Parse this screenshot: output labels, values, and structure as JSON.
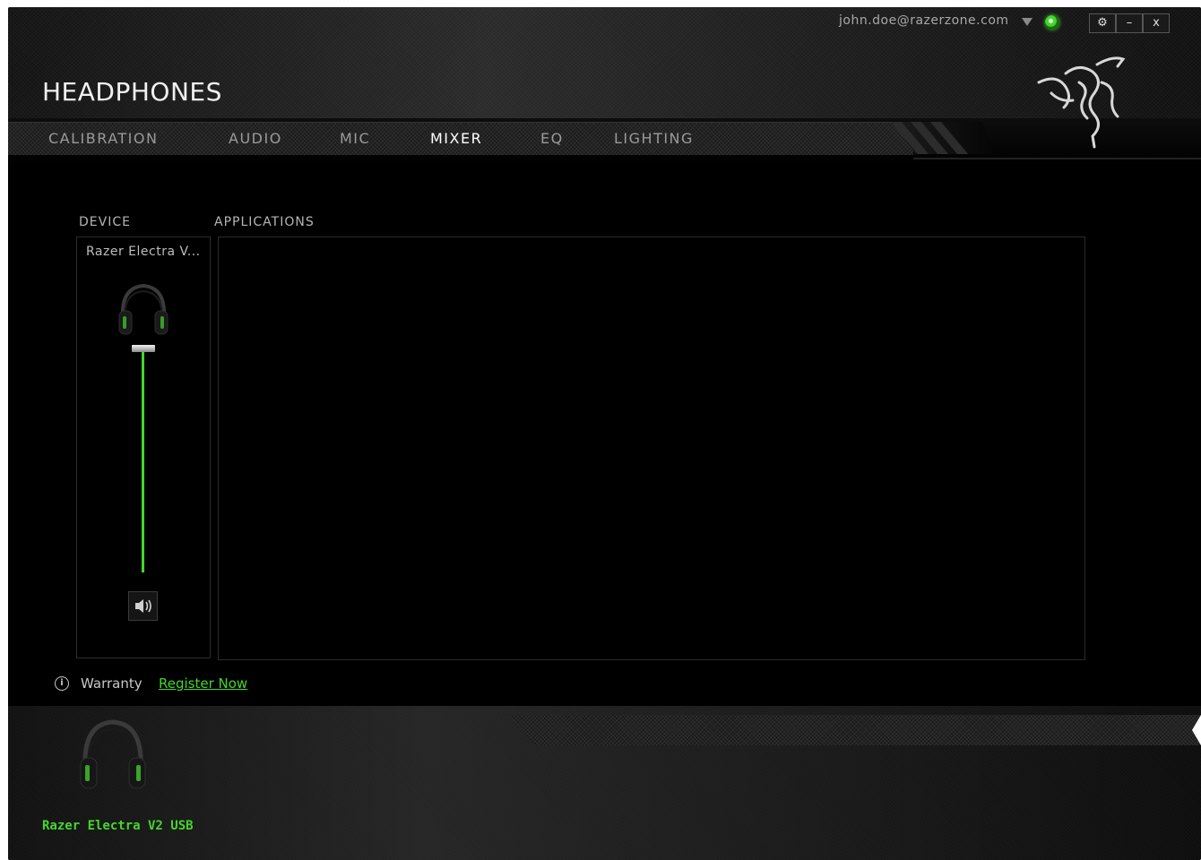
{
  "account": {
    "email": "john.doe@razerzone.com"
  },
  "window_controls": {
    "settings": "⚙",
    "minimize": "–",
    "close": "x"
  },
  "app": {
    "title": "HEADPHONES"
  },
  "tabs": [
    {
      "label": "CALIBRATION",
      "active": false
    },
    {
      "label": "AUDIO",
      "active": false
    },
    {
      "label": "MIC",
      "active": false
    },
    {
      "label": "MIXER",
      "active": true
    },
    {
      "label": "EQ",
      "active": false
    },
    {
      "label": "LIGHTING",
      "active": false
    }
  ],
  "mixer": {
    "device_header": "DEVICE",
    "applications_header": "APPLICATIONS",
    "device_name": "Razer Electra V...",
    "volume_level": 1.0
  },
  "warranty": {
    "label": "Warranty",
    "link": "Register Now"
  },
  "footer": {
    "device_name": "Razer Electra V2 USB"
  },
  "colors": {
    "accent": "#44d62c",
    "background": "#000000"
  },
  "icons": [
    "headset-icon",
    "speaker-icon",
    "info-icon",
    "gear-icon",
    "minimize-icon",
    "close-icon",
    "razer-logo",
    "status-icon",
    "dropdown-caret-icon"
  ]
}
